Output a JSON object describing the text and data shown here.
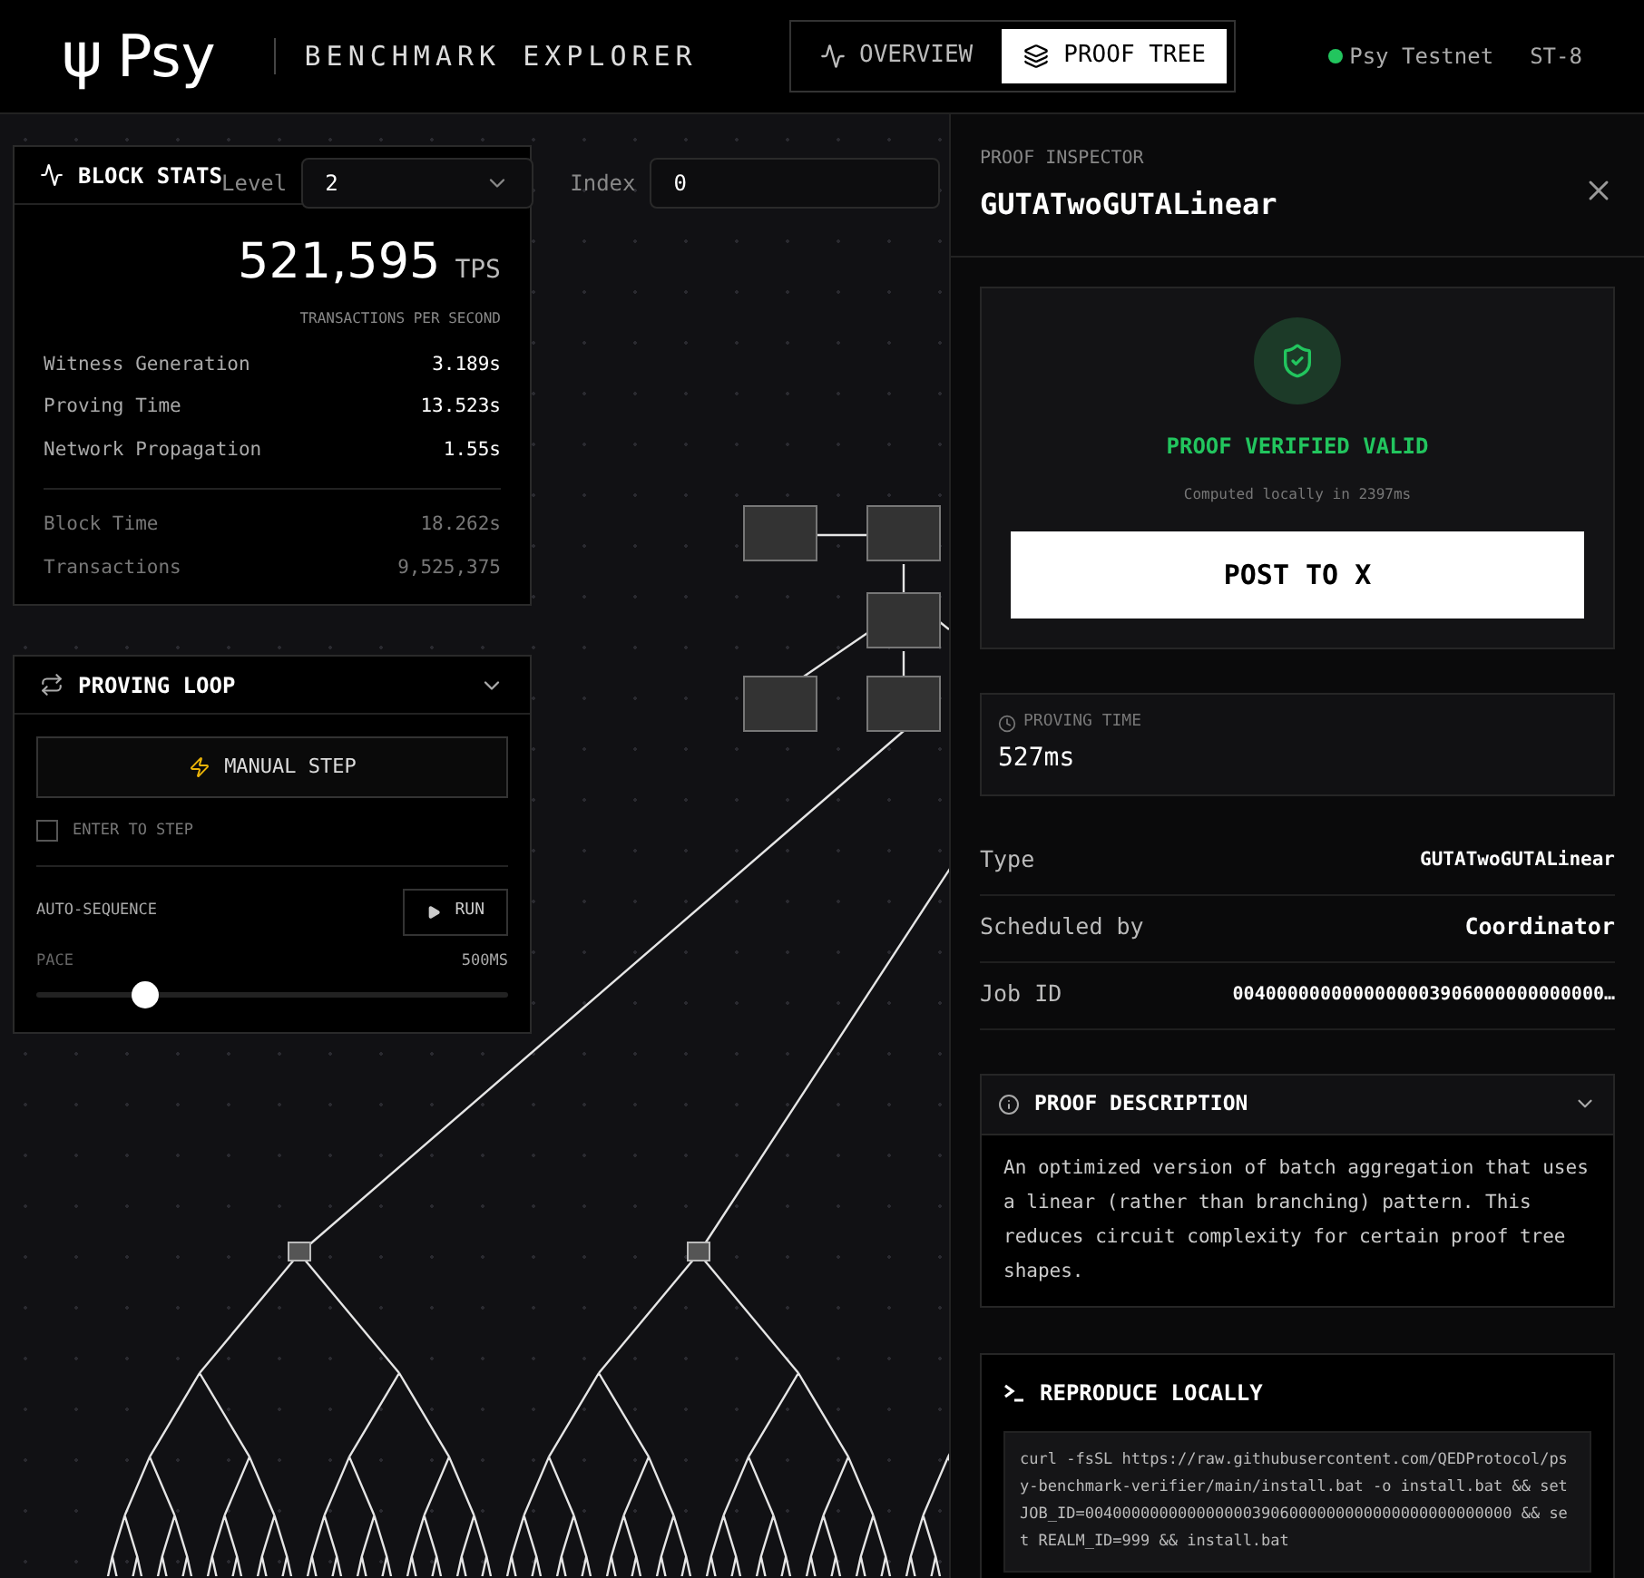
{
  "header": {
    "logo_symbol": "ψ",
    "logo_text": "Psy",
    "app_title": "BENCHMARK EXPLORER",
    "tabs": [
      {
        "label": "OVERVIEW",
        "selected": false,
        "kind": "activity"
      },
      {
        "label": "PROOF TREE",
        "selected": true,
        "kind": "layers"
      }
    ],
    "network": {
      "name": "Psy Testnet",
      "color": "#22c55e"
    },
    "chain": "ST-8"
  },
  "toolbar": {
    "level_label": "Level",
    "level_value": "2",
    "index_label": "Index",
    "index_value": "0"
  },
  "block_stats": {
    "title": "BLOCK STATS",
    "tps_value": "521,595",
    "tps_unit": "TPS",
    "tps_caption": "TRANSACTIONS PER SECOND",
    "primary_metrics": [
      {
        "label": "Witness Generation",
        "value": "3.189s"
      },
      {
        "label": "Proving Time",
        "value": "13.523s"
      },
      {
        "label": "Network Propagation",
        "value": "1.55s"
      }
    ],
    "block_metrics": [
      {
        "label": "Block Time",
        "value": "18.262s"
      },
      {
        "label": "Transactions",
        "value": "9,525,375"
      }
    ]
  },
  "proving_loop": {
    "title": "PROVING LOOP",
    "expanded": true,
    "manual_step": "MANUAL STEP",
    "enter_to_step": {
      "label": "ENTER TO STEP",
      "checked": false
    },
    "auto_sequence_label": "AUTO-SEQUENCE",
    "run_button": "RUN",
    "pace_label": "PACE",
    "pace_value": "500MS",
    "pace": {
      "level": 0.23
    }
  },
  "inspector": {
    "eyebrow": "PROOF INSPECTOR",
    "title": "GUTATwoGUTALinear",
    "verification": {
      "status": "PROOF VERIFIED VALID",
      "computed": "Computed locally in 2397ms",
      "post_button": "POST TO X"
    },
    "proving_time": {
      "label": "PROVING TIME",
      "value": "527ms"
    },
    "fields": [
      {
        "label": "Type",
        "value": "GUTATwoGUTALinear"
      },
      {
        "label": "Scheduled by",
        "value": "Coordinator"
      },
      {
        "label": "Job ID",
        "value": "0040000000000000003906000000000000…"
      }
    ],
    "description": {
      "title": "PROOF DESCRIPTION",
      "expanded": true,
      "text": "An optimized version of batch aggregation that uses a linear (rather than branching) pattern. This reduces circuit complexity for certain proof tree shapes."
    },
    "reproduce": {
      "title": "REPRODUCE LOCALLY",
      "command": "curl -fsSL https://raw.githubusercontent.com/QEDProtocol/psy-benchmark-verifier/main/install.bat -o install.bat && set JOB_ID=0040000000000000003906000000000000000000000000 && set REALM_ID=999 && install.bat"
    }
  }
}
